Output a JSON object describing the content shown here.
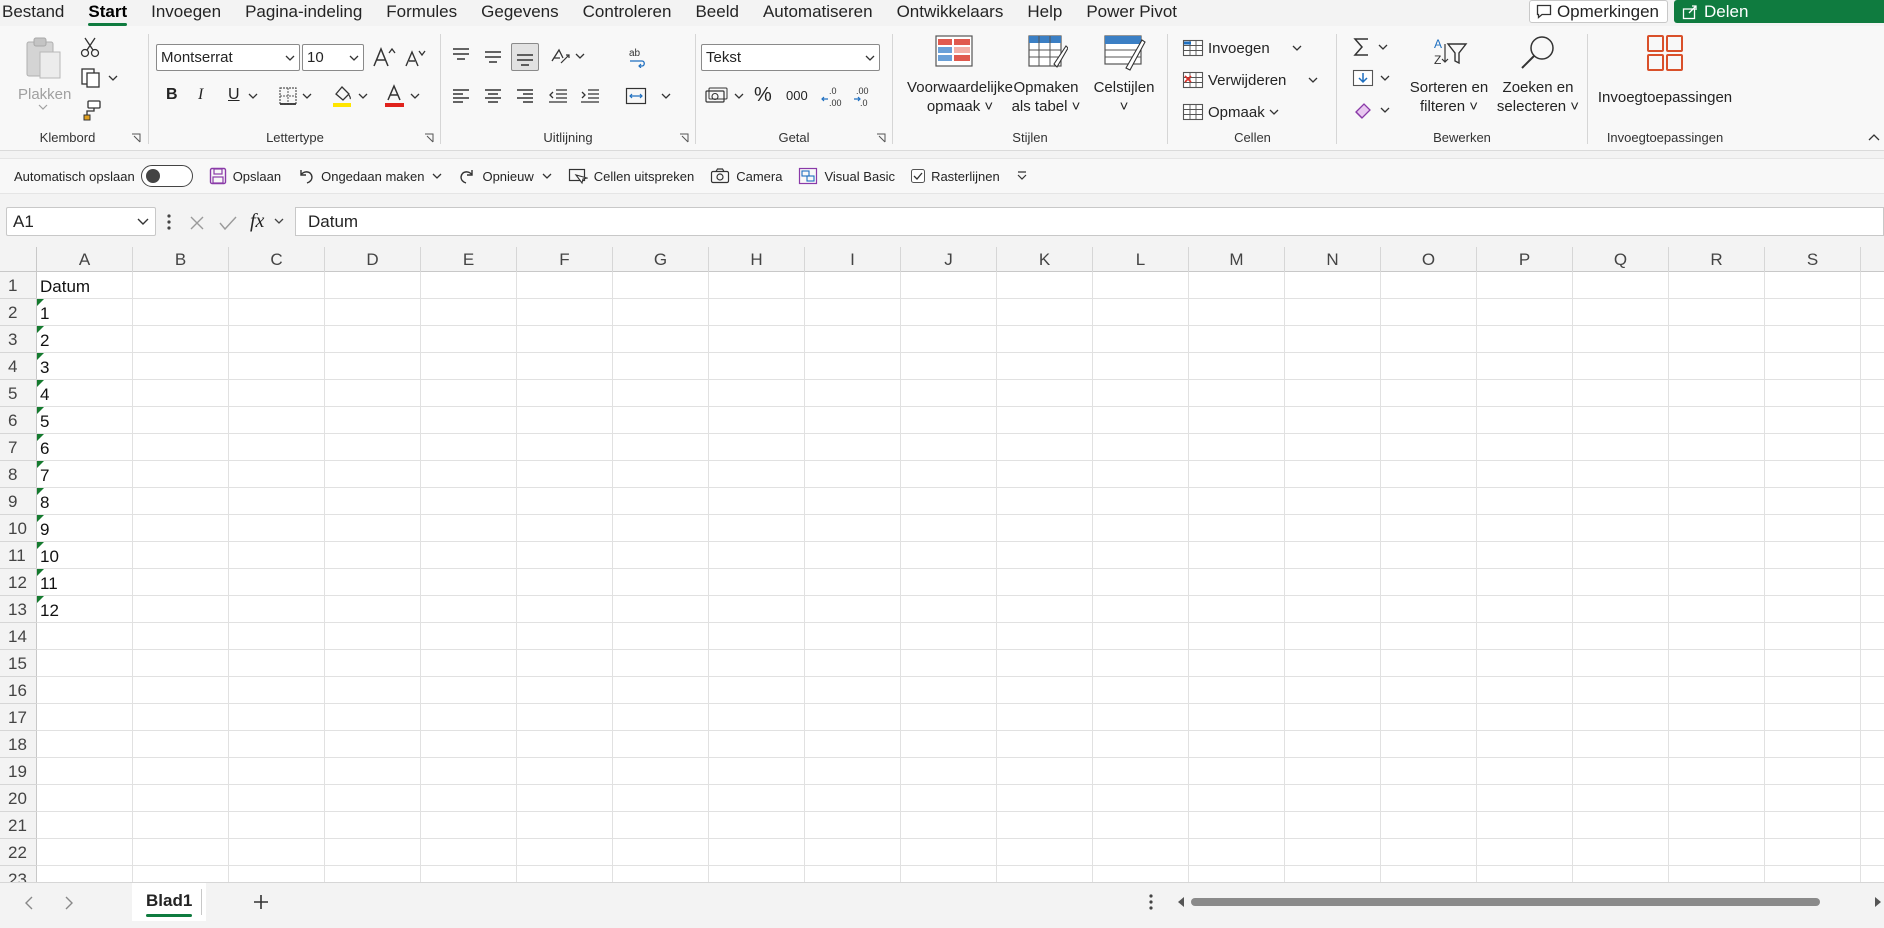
{
  "menu": {
    "tabs": [
      "Bestand",
      "Start",
      "Invoegen",
      "Pagina-indeling",
      "Formules",
      "Gegevens",
      "Controleren",
      "Beeld",
      "Automatiseren",
      "Ontwikkelaars",
      "Help",
      "Power Pivot"
    ],
    "active_tab": "Start",
    "comments_label": "Opmerkingen",
    "share_label": "Delen"
  },
  "ribbon": {
    "clipboard": {
      "paste_label": "Plakken",
      "group_label": "Klembord"
    },
    "font": {
      "font_name": "Montserrat",
      "font_size": "10",
      "group_label": "Lettertype",
      "bold": "B",
      "italic": "I",
      "underline": "U"
    },
    "alignment": {
      "group_label": "Uitlijning"
    },
    "number": {
      "format": "Tekst",
      "group_label": "Getal",
      "thousands": "000"
    },
    "styles": {
      "conditional_line1": "Voorwaardelijke",
      "conditional_line2": "opmaak",
      "table_line1": "Opmaken",
      "table_line2": "als tabel",
      "cellstyles_label": "Celstijlen",
      "group_label": "Stijlen"
    },
    "cells": {
      "insert_label": "Invoegen",
      "delete_label": "Verwijderen",
      "format_label": "Opmaak",
      "group_label": "Cellen"
    },
    "editing": {
      "sort_line1": "Sorteren en",
      "sort_line2": "filteren",
      "find_line1": "Zoeken en",
      "find_line2": "selecteren",
      "group_label": "Bewerken"
    },
    "addins": {
      "label": "Invoegtoepassingen",
      "group_label": "Invoegtoepassingen"
    }
  },
  "qat": {
    "autosave_label": "Automatisch opslaan",
    "save_label": "Opslaan",
    "undo_label": "Ongedaan maken",
    "redo_label": "Opnieuw",
    "speak_label": "Cellen uitspreken",
    "camera_label": "Camera",
    "vba_label": "Visual Basic",
    "gridlines_label": "Rasterlijnen"
  },
  "formula_bar": {
    "name_box": "A1",
    "formula": "Datum"
  },
  "grid": {
    "columns": [
      "A",
      "B",
      "C",
      "D",
      "E",
      "F",
      "G",
      "H",
      "I",
      "J",
      "K",
      "L",
      "M",
      "N",
      "O",
      "P",
      "Q",
      "R",
      "S"
    ],
    "rows": [
      "1",
      "2",
      "3",
      "4",
      "5",
      "6",
      "7",
      "8",
      "9",
      "10",
      "11",
      "12",
      "13",
      "14",
      "15",
      "16",
      "17",
      "18",
      "19",
      "20",
      "21",
      "22",
      "23"
    ],
    "column_a": [
      "Datum",
      "1",
      "2",
      "3",
      "4",
      "5",
      "6",
      "7",
      "8",
      "9",
      "10",
      "11",
      "12"
    ]
  },
  "sheets": {
    "active": "Blad1"
  },
  "colors": {
    "accent": "#0f7b3f",
    "error_indicator": "#147a2e"
  }
}
